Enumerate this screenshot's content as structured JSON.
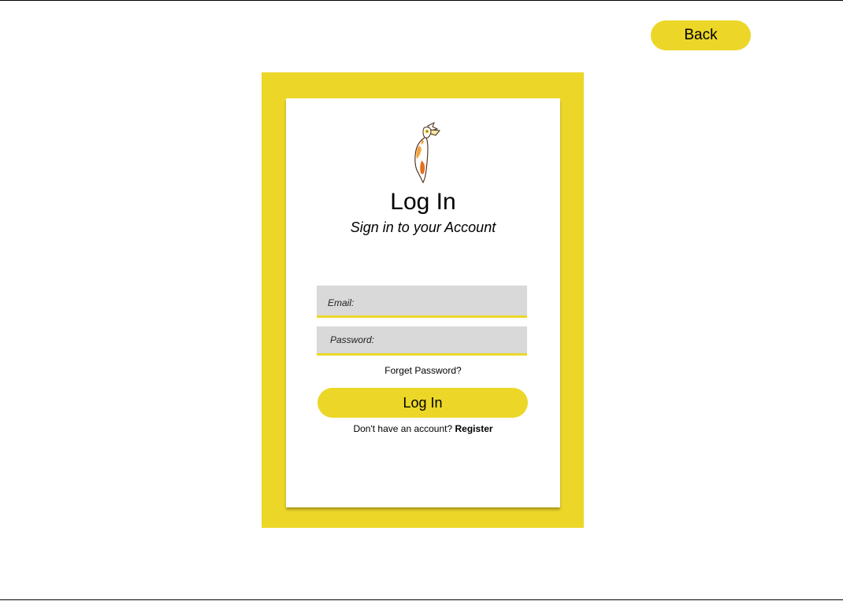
{
  "header": {
    "back_label": "Back"
  },
  "login": {
    "title": "Log In",
    "subtitle": "Sign in to your Account",
    "email_placeholder": "Email:",
    "email_value": "",
    "password_placeholder": "Password:",
    "password_value": "",
    "forget_label": "Forget Password?",
    "submit_label": "Log In",
    "register_prompt": "Don't have an account?",
    "register_label": "Register"
  },
  "logo": {
    "icon": "hornbill-bird-icon"
  },
  "colors": {
    "accent": "#ecd728",
    "field_bg": "#d9d9d9",
    "card_bg": "#ffffff",
    "text": "#000000",
    "logo_orange": "#e8701e",
    "logo_outline": "#4a2a14"
  }
}
